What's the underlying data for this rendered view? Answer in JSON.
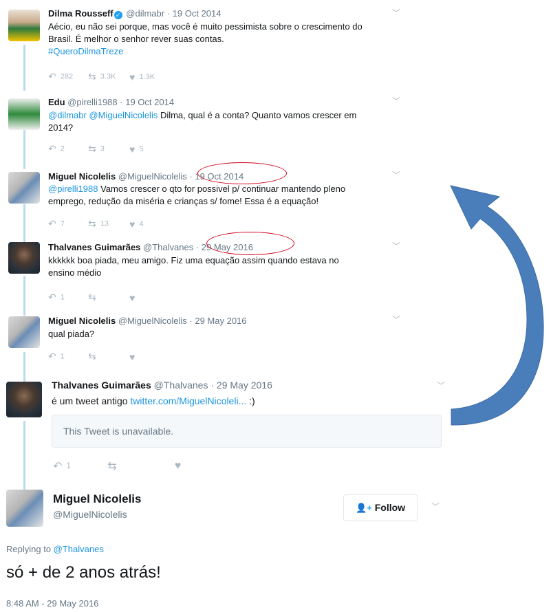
{
  "tweets": [
    {
      "name": "Dilma Rousseff",
      "verified": true,
      "handle": "@dilmabr",
      "date": "19 Oct 2014",
      "text_line1": "Aécio, eu não sei porque, mas você é muito pessimista sobre o crescimento do",
      "text_line2": "Brasil. É melhor o senhor rever suas contas.",
      "hashtag": "#QueroDilmaTreze",
      "replies": "282",
      "retweets": "3.3K",
      "likes": "1.3K"
    },
    {
      "name": "Edu",
      "handle": "@pirelli1988",
      "date": "19 Oct 2014",
      "mentions": "@dilmabr @MiguelNicolelis",
      "text_line1": " Dilma, qual é a conta? Quanto vamos crescer em",
      "text_line2": "2014?",
      "replies": "2",
      "retweets": "3",
      "likes": "5"
    },
    {
      "name": "Miguel Nicolelis",
      "handle": "@MiguelNicolelis",
      "date": "19 Oct 2014",
      "mention": "@pirelli1988",
      "text_line1": " Vamos crescer o qto for possivel p/ continuar mantendo pleno",
      "text_line2": "emprego, redução da miséria e crianças s/ fome! Essa é a equação!",
      "replies": "7",
      "retweets": "13",
      "likes": "4"
    },
    {
      "name": "Thalvanes Guimarães",
      "handle": "@Thalvanes",
      "date": "29 May 2016",
      "text_line1": "kkkkkk boa piada, meu amigo. Fiz uma equação assim quando estava no",
      "text_line2": "ensino médio",
      "replies": "1",
      "retweets": "",
      "likes": ""
    },
    {
      "name": "Miguel Nicolelis",
      "handle": "@MiguelNicolelis",
      "date": "29 May 2016",
      "text_line1": "qual piada?",
      "replies": "1",
      "retweets": "",
      "likes": ""
    },
    {
      "name": "Thalvanes Guimarães",
      "handle": "@Thalvanes",
      "date": "29 May 2016",
      "text_line1": "é um tweet antigo ",
      "link": "twitter.com/MiguelNicoleli...",
      "text_after_link": " :)",
      "quoted": "This Tweet is unavailable.",
      "replies": "1",
      "retweets": "",
      "likes": ""
    }
  ],
  "main": {
    "name": "Miguel Nicolelis",
    "handle": "@MiguelNicolelis",
    "follow_label": "Follow",
    "replying_prefix": "Replying to ",
    "replying_to": "@Thalvanes",
    "text": "só + de 2 anos atrás!",
    "timestamp": "8:48 AM - 29 May 2016"
  },
  "icons": {
    "reply": "reply-icon",
    "retweet": "retweet-icon",
    "like": "heart-icon",
    "chevron": "chevron-down-icon",
    "follow": "add-user-icon"
  },
  "colors": {
    "link": "#1b95e0",
    "annotation": "#d0021b",
    "arrow": "#4a7ebb",
    "thread_line": "#b8dcef"
  }
}
